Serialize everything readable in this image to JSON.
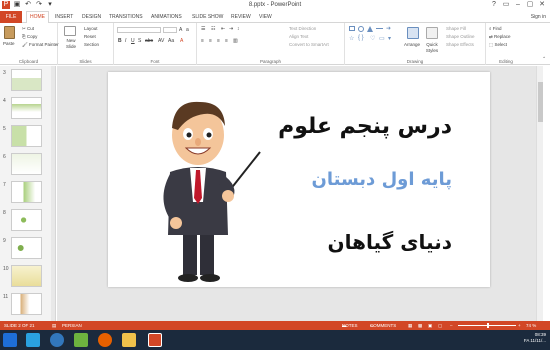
{
  "window": {
    "title": "8.pptx - PowerPoint",
    "controls": [
      "?",
      "▭",
      "–",
      "▢",
      "✕"
    ]
  },
  "tabs": [
    "FILE",
    "HOME",
    "INSERT",
    "DESIGN",
    "TRANSITIONS",
    "ANIMATIONS",
    "SLIDE SHOW",
    "REVIEW",
    "VIEW"
  ],
  "active_tab": "HOME",
  "sign_in": "Sign in",
  "ribbon": {
    "clipboard": {
      "label": "Clipboard",
      "paste": "Paste",
      "cut": "Cut",
      "copy": "Copy",
      "format_painter": "Format Painter"
    },
    "slides": {
      "label": "Slides",
      "new_slide": "New Slide",
      "layout": "Layout",
      "reset": "Reset",
      "section": "Section"
    },
    "font": {
      "label": "Font"
    },
    "paragraph": {
      "label": "Paragraph",
      "text_direction": "Text Direction",
      "align_text": "Align Text",
      "convert_smartart": "Convert to SmartArt"
    },
    "drawing": {
      "label": "Drawing",
      "arrange": "Arrange",
      "quick_styles": "Quick Styles",
      "shape_fill": "Shape Fill",
      "shape_outline": "Shape Outline",
      "shape_effects": "Shape Effects"
    },
    "editing": {
      "label": "Editing",
      "find": "Find",
      "replace": "Replace",
      "select": "Select"
    }
  },
  "thumbnails": [
    "3",
    "4",
    "5",
    "6",
    "7",
    "8",
    "9",
    "10",
    "11"
  ],
  "slide": {
    "line1": "درس پنجم علوم",
    "line2": "پایه اول دبستان",
    "line3": "دنیای گیاهان"
  },
  "status": {
    "slide_info": "SLIDE 2 OF 21",
    "language": "PERSIAN",
    "notes": "NOTES",
    "comments": "COMMENTS",
    "zoom": "74 %"
  },
  "tray": {
    "time": "08:39",
    "lang": "FA",
    "date": "11/11/..."
  },
  "colors": {
    "accent": "#d24726",
    "taskbar": "#1b2a3d"
  }
}
